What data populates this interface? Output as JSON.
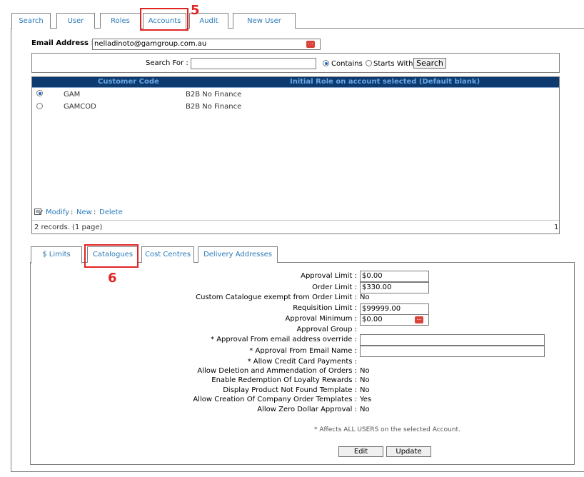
{
  "top_tabs": [
    "Search",
    "User",
    "Roles",
    "Accounts",
    "Audit",
    "New User"
  ],
  "annotations": {
    "step5": "5",
    "step6": "6"
  },
  "email": {
    "label": "Email Address :",
    "value": "nelladinoto@gamgroup.com.au"
  },
  "search": {
    "label": "Search For :",
    "value": "",
    "contains_label": "Contains",
    "starts_with_label": "Starts With",
    "button": "Search",
    "mode": "contains"
  },
  "grid": {
    "headers": [
      "Customer Code",
      "Initial Role on account selected (Default blank)"
    ],
    "rows": [
      {
        "code": "GAM",
        "role": "B2B No Finance",
        "selected": true
      },
      {
        "code": "GAMCOD",
        "role": "B2B No Finance",
        "selected": false
      }
    ],
    "actions": {
      "modify": "Modify",
      "sep1": ":",
      "new": "New",
      "sep2": ":",
      "delete": "Delete"
    },
    "records": "2 records. (1 page)",
    "page": "1"
  },
  "bottom_tabs": [
    "$ Limits",
    "Catalogues",
    "Cost Centres",
    "Delivery Addresses"
  ],
  "limits": {
    "approval_limit": {
      "label": "Approval Limit :",
      "value": "$0.00"
    },
    "order_limit": {
      "label": "Order Limit :",
      "value": "$330.00"
    },
    "custom_catalogue": {
      "label": "Custom Catalogue exempt from Order Limit :",
      "value": "No"
    },
    "requisition_limit": {
      "label": "Requisition Limit :",
      "value": "$99999.00"
    },
    "approval_minimum": {
      "label": "Approval Minimum :",
      "value": "$0.00"
    },
    "approval_group": {
      "label": "Approval Group :",
      "value": ""
    },
    "approval_email_override": {
      "label": "* Approval From email address override :",
      "value": ""
    },
    "approval_email_name": {
      "label": "* Approval From Email Name :",
      "value": ""
    },
    "credit_card": {
      "label": "* Allow Credit Card Payments :",
      "value": ""
    },
    "deletion_amendment": {
      "label": "Allow Deletion and Ammendation of Orders :",
      "value": "No"
    },
    "loyalty": {
      "label": "Enable Redemption Of Loyalty Rewards :",
      "value": "No"
    },
    "product_not_found": {
      "label": "Display Product Not Found Template :",
      "value": "No"
    },
    "company_templates": {
      "label": "Allow Creation Of Company Order Templates :",
      "value": "Yes"
    },
    "zero_dollar": {
      "label": "Allow Zero Dollar Approval :",
      "value": "No"
    }
  },
  "footnote": "* Affects ALL USERS on the selected Account.",
  "buttons": {
    "edit": "Edit",
    "update": "Update"
  },
  "colors": {
    "header_bg": "#0e3b6f",
    "header_text": "#68a8e6",
    "link": "#2a7ab8",
    "annotation": "#e02424"
  }
}
